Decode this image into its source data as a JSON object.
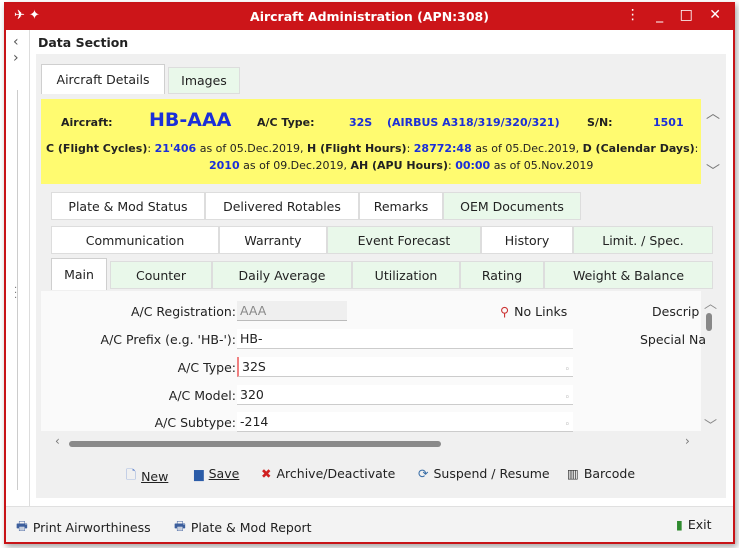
{
  "window": {
    "title": "Aircraft Administration (APN:308)",
    "controls": "⋮ _ □ ✕"
  },
  "section_header": "Data Section",
  "top_tabs": [
    {
      "label": "Aircraft Details",
      "active": true
    },
    {
      "label": "Images",
      "active": false
    }
  ],
  "info": {
    "aircraft_label": "Aircraft:",
    "aircraft_value": "HB-AAA",
    "type_label": "A/C Type:",
    "type_code": "32S",
    "type_desc": "(AIRBUS A318/319/320/321)",
    "sn_label": "S/N:",
    "sn_value": "1501",
    "c_label": "C (Flight Cycles)",
    "c_value": "21'406",
    "c_date": "as of 05.Dec.2019,",
    "h_label": "H (Flight Hours)",
    "h_value": "28772:48",
    "h_date": "as of 05.Dec.2019,",
    "d_label": "D (Calendar Days)",
    "d_value": "2010",
    "d_date": "as of 09.Dec.2019,",
    "ah_label": "AH (APU Hours)",
    "ah_value": "00:00",
    "ah_date": "as of 05.Nov.2019"
  },
  "tabs_row1": [
    "Plate & Mod Status",
    "Delivered Rotables",
    "Remarks",
    "OEM Documents"
  ],
  "tabs_row2": [
    "Communication",
    "Warranty",
    "Event Forecast",
    "History",
    "Limit. / Spec."
  ],
  "tabs_row3": [
    "Main",
    "Counter",
    "Daily Average",
    "Utilization",
    "Rating",
    "Weight & Balance"
  ],
  "form": {
    "registration_label": "A/C Registration:",
    "registration_value": "AAA",
    "no_links": "No Links",
    "descrip_label": "Descrip",
    "special_label": "Special Na",
    "prefix_label": "A/C Prefix (e.g. 'HB-'):",
    "prefix_value": "HB-",
    "type_label": "A/C Type:",
    "type_value": "32S",
    "model_label": "A/C Model:",
    "model_value": "320",
    "subtype_label": "A/C Subtype:",
    "subtype_value": "-214"
  },
  "actions": {
    "new": "New",
    "save": "Save",
    "archive": "Archive/Deactivate",
    "suspend": "Suspend / Resume",
    "barcode": "Barcode"
  },
  "bottom": {
    "print_airworthiness": "Print Airworthiness",
    "plate_mod_report": "Plate & Mod Report",
    "exit": "Exit"
  },
  "colors": {
    "title_bar": "#cc1519",
    "info_bg": "#fffb70",
    "info_value": "#1b2fd8",
    "inactive_tab": "#e9f8ea"
  }
}
